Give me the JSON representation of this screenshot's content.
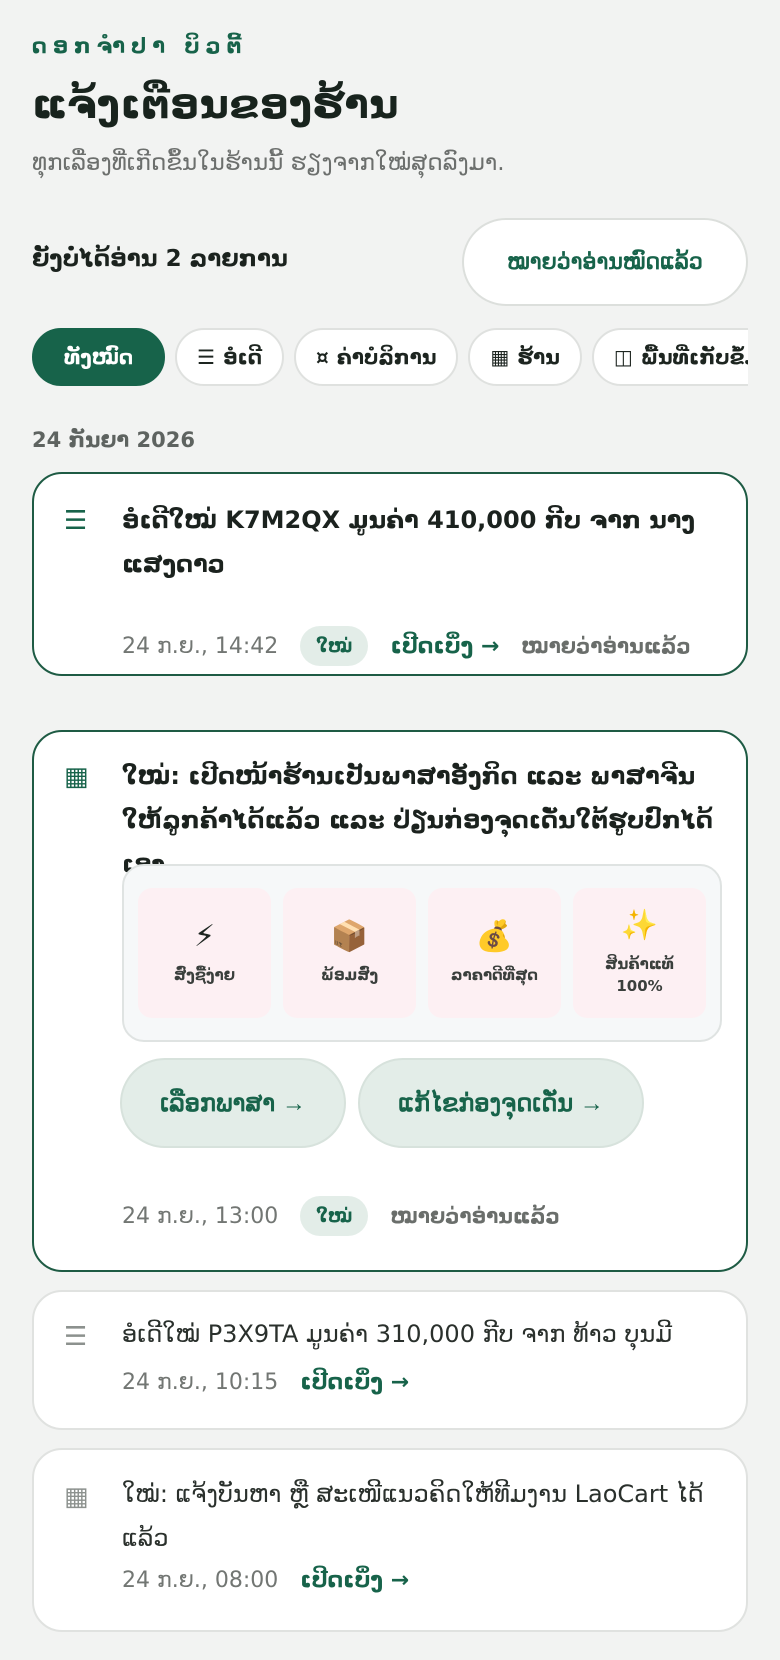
{
  "header": {
    "brand": "ດອກຈຳປາ ບິວຕີ້",
    "title": "ແຈ້ງເຕືອນຂອງຮ້ານ",
    "subtitle": "ທຸກເລື່ອງທີ່ເກີດຂຶ້ນໃນຮ້ານນີ້ ຮຽງຈາກໃໝ່ສຸດລົງມາ."
  },
  "unread_summary": "ຍັງບໍ່ໄດ້ອ່ານ 2 ລາຍການ",
  "mark_all_read_label": "ໝາຍວ່າອ່ານໝົດແລ້ວ",
  "filters": [
    {
      "icon": "",
      "label": "ທັງໝົດ"
    },
    {
      "icon": "☰",
      "label": "ອໍເດີ"
    },
    {
      "icon": "¤",
      "label": "ຄ່າບໍລິການ"
    },
    {
      "icon": "▦",
      "label": "ຮ້ານ"
    },
    {
      "icon": "◫",
      "label": "ພື້ນທີ່ເກັບຂໍ້ມູ"
    }
  ],
  "date_group": "24 ກັນຍາ 2026",
  "notifications": [
    {
      "icon": "☰",
      "text": "ອໍເດີໃໝ່ K7M2QX ມູນຄ່າ 410,000 ກີບ ຈາກ ນາງ ແສງດາວ",
      "time": "24 ກ.ຍ., 14:42",
      "badge": "ໃໝ່",
      "open_label": "ເປີດເບິ່ງ →",
      "mark_read_label": "ໝາຍວ່າອ່ານແລ້ວ"
    },
    {
      "icon": "▦",
      "text": "ໃໝ່: ເປີດໜ້າຮ້ານເປັນພາສາອັງກິດ ແລະ ພາສາຈີນໃຫ້ລູກຄ້າໄດ້ແລ້ວ ແລະ ປ່ຽນກ່ອງຈຸດເດັ່ນໃຕ້ຮູບປົກໄດ້ເອງ",
      "features": [
        {
          "icon": "⚡",
          "label": "ສົ່ງຊື້ງ່າຍ"
        },
        {
          "icon": "📦",
          "label": "ພ້ອມສົ່ງ"
        },
        {
          "icon": "💰",
          "label": "ລາຄາດີທີ່ສຸດ"
        },
        {
          "icon": "✨",
          "label": "ສິນຄ້າແທ້ 100%"
        }
      ],
      "action_language": "ເລືອກພາສາ →",
      "action_highlight": "ແກ້ໄຂກ່ອງຈຸດເດັ່ນ →",
      "time": "24 ກ.ຍ., 13:00",
      "badge": "ໃໝ່",
      "mark_read_label": "ໝາຍວ່າອ່ານແລ້ວ"
    },
    {
      "icon": "☰",
      "text": "ອໍເດີໃໝ່ P3X9TA ມູນຄ່າ 310,000 ກີບ ຈາກ ທ້າວ ບຸນມີ",
      "time": "24 ກ.ຍ., 10:15",
      "open_label": "ເປີດເບິ່ງ →"
    },
    {
      "icon": "▦",
      "text": "ໃໝ່: ແຈ້ງບັນຫາ ຫຼື ສະເໜີແນວຄິດໃຫ້ທີມງານ LaoCart ໄດ້ແລ້ວ",
      "time": "24 ກ.ຍ., 08:00",
      "open_label": "ເປີດເບິ່ງ →"
    }
  ]
}
